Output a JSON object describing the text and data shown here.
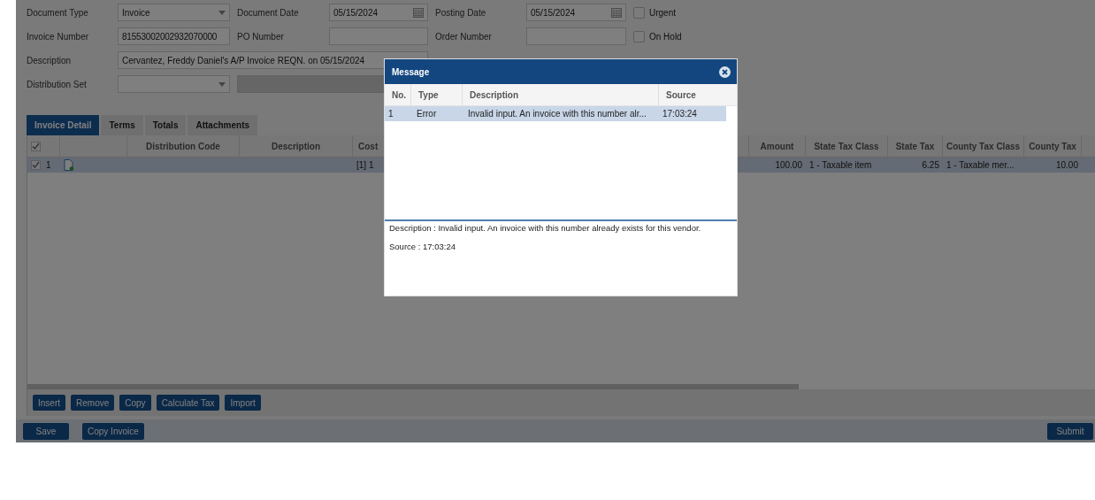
{
  "form": {
    "rows": [
      [
        {
          "kind": "label",
          "text": "Document Type"
        },
        {
          "kind": "select",
          "value": "Invoice"
        },
        {
          "kind": "label",
          "text": "Document Date"
        },
        {
          "kind": "date",
          "value": "05/15/2024"
        },
        {
          "kind": "label",
          "text": "Posting Date"
        },
        {
          "kind": "date",
          "value": "05/15/2024"
        },
        {
          "kind": "checkbox",
          "label": "Urgent",
          "checked": false
        }
      ],
      [
        {
          "kind": "label",
          "text": "Invoice Number"
        },
        {
          "kind": "text",
          "value": "81553002002932070000"
        },
        {
          "kind": "label",
          "text": "PO Number"
        },
        {
          "kind": "text"
        },
        {
          "kind": "label",
          "text": "Order Number"
        },
        {
          "kind": "text"
        },
        {
          "kind": "checkbox",
          "label": "On Hold",
          "checked": false
        }
      ],
      [
        {
          "kind": "label",
          "text": "Description"
        },
        {
          "kind": "wide",
          "value": "Cervantez, Freddy Daniel's A/P Invoice REQN. on 05/15/2024"
        }
      ],
      [
        {
          "kind": "label",
          "text": "Distribution Set"
        },
        {
          "kind": "select"
        },
        {
          "kind": "disabled"
        }
      ]
    ]
  },
  "tabs": [
    {
      "label": "Invoice Detail",
      "selected": true
    },
    {
      "label": "Terms",
      "selected": false
    },
    {
      "label": "Totals",
      "selected": false
    },
    {
      "label": "Attachments",
      "selected": false
    }
  ],
  "grid": {
    "all_checked": true,
    "columns": [
      {
        "kind": "check"
      },
      {
        "kind": "spacer"
      },
      {
        "kind": "text",
        "label": "Distribution Code"
      },
      {
        "kind": "text",
        "label": "Description"
      },
      {
        "kind": "cut",
        "label": "Cost"
      },
      {
        "kind": "num",
        "label": "Amount"
      },
      {
        "kind": "text",
        "label": "State Tax Class"
      },
      {
        "kind": "num",
        "label": "State Tax"
      },
      {
        "kind": "text",
        "label": "County Tax Class"
      },
      {
        "kind": "num",
        "label": "County Tax"
      },
      {
        "kind": "spacer"
      }
    ],
    "rows": [
      {
        "selected": true,
        "checked": true,
        "line": "1",
        "cells": [
          null,
          null,
          null,
          null,
          "[1] 1",
          "100.00",
          "1 - Taxable item",
          "6.25",
          "1 - Taxable mer...",
          "10.00",
          null
        ]
      }
    ]
  },
  "grid_buttons": [
    "Insert",
    "Remove",
    "Copy",
    "Calculate Tax",
    "Import"
  ],
  "footer": {
    "left_buttons": [
      "Save",
      "Copy Invoice"
    ],
    "right_buttons": [
      "Submit"
    ]
  },
  "dialog": {
    "title": "Message",
    "columns": [
      "No.",
      "Type",
      "Description",
      "Source"
    ],
    "rows": [
      {
        "selected": true,
        "cells": [
          "1",
          "Error",
          "Invalid input. An invoice with this number alr...",
          "17:03:24"
        ]
      }
    ],
    "details": [
      "Description : Invalid input. An invoice with this number already exists for this vendor.",
      "Source : 17:03:24"
    ]
  }
}
